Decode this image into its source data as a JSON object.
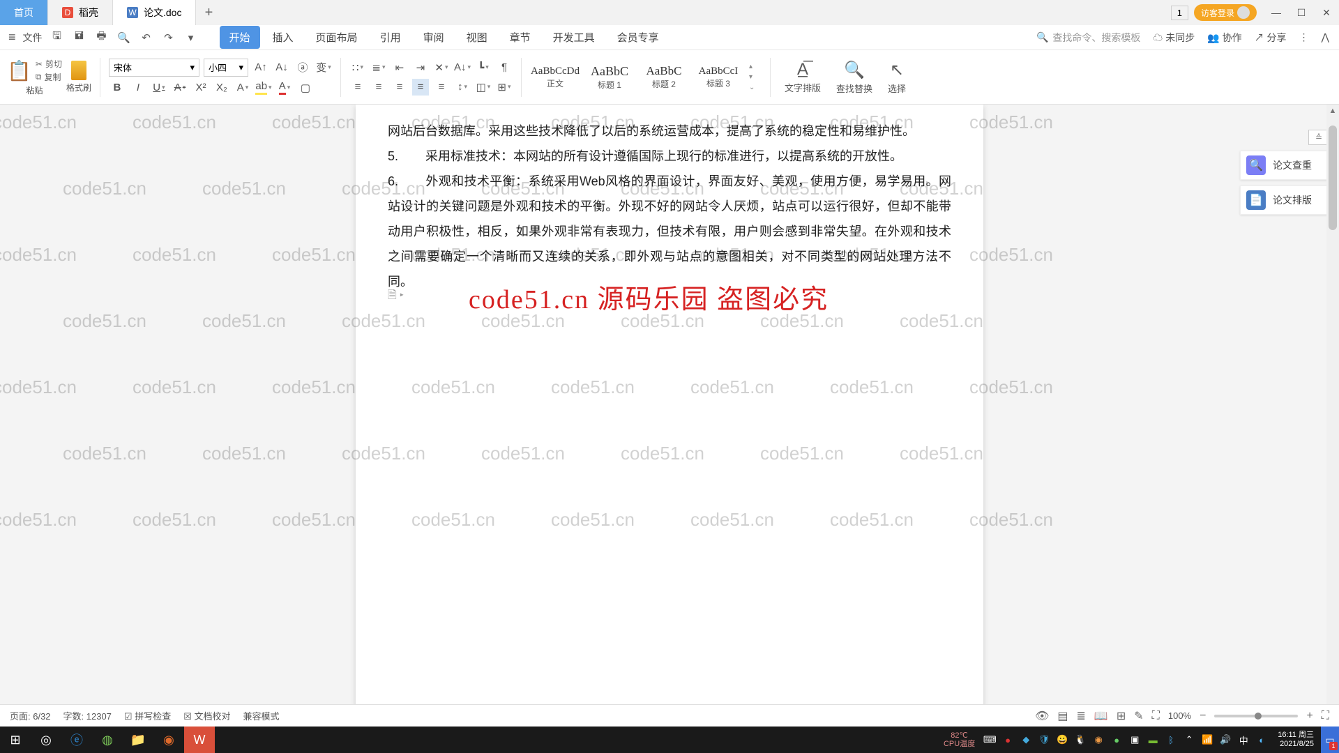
{
  "tabs": {
    "home": "首页",
    "docell": "稻壳",
    "doc": "论文.doc"
  },
  "win": {
    "badge": "1",
    "login": "访客登录"
  },
  "qb": {
    "file": "文件",
    "menu": [
      "开始",
      "插入",
      "页面布局",
      "引用",
      "审阅",
      "视图",
      "章节",
      "开发工具",
      "会员专享"
    ],
    "search": "查找命令、搜索模板",
    "unsync": "未同步",
    "collab": "协作",
    "share": "分享"
  },
  "ribbon": {
    "paste": "粘贴",
    "cut": "剪切",
    "copy": "复制",
    "format": "格式刷",
    "font": "宋体",
    "size": "小四",
    "styles": [
      {
        "sample": "AaBbCcDd",
        "name": "正文"
      },
      {
        "sample": "AaBbC",
        "name": "标题 1"
      },
      {
        "sample": "AaBbC",
        "name": "标题 2"
      },
      {
        "sample": "AaBbCcI",
        "name": "标题 3"
      }
    ],
    "textlayout": "文字排版",
    "findreplace": "查找替换",
    "select": "选择"
  },
  "doc": {
    "p1": "网站后台数据库。采用这些技术降低了以后的系统运营成本，提高了系统的稳定性和易维护性。",
    "p2num": "5.",
    "p2": "采用标准技术：本网站的所有设计遵循国际上现行的标准进行，以提高系统的开放性。",
    "p3num": "6.",
    "p3": "外观和技术平衡：系统采用Web风格的界面设计，界面友好、美观，使用方便，易学易用。网站设计的关键问题是外观和技术的平衡。外现不好的网站令人厌烦，站点可以运行很好，但却不能带动用户积极性，相反，如果外观非常有表现力，但技术有限，用户则会感到非常失望。在外观和技术之间需要确定一个清晰而又连续的关系，即外观与站点的意图相关，对不同类型的网站处理方法不同。"
  },
  "overlay": "code51.cn 源码乐园 盗图必究",
  "wm": "code51.cn",
  "side": {
    "check": "论文查重",
    "layout": "论文排版"
  },
  "status": {
    "page": "页面: 6/32",
    "words": "字数: 12307",
    "spell": "拼写检查",
    "proof": "文档校对",
    "compat": "兼容模式",
    "zoom": "100%"
  },
  "taskbar": {
    "cpu": "82℃",
    "cpulabel": "CPU温度",
    "ime": "中",
    "time": "16:11 周三",
    "date": "2021/8/25",
    "notif": "1"
  }
}
